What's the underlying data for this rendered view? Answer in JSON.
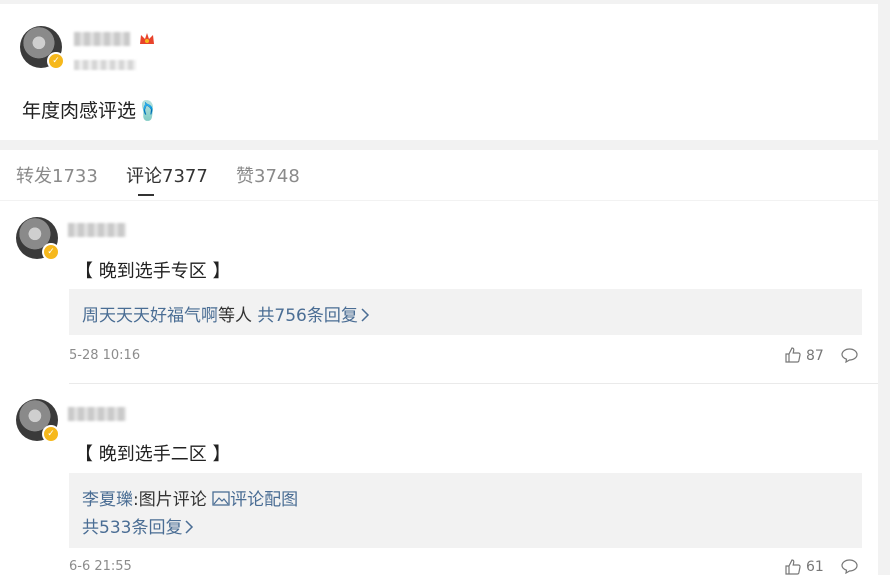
{
  "post": {
    "author_name": "",
    "time": "",
    "text": "年度肉感评选🩴"
  },
  "tabs": [
    {
      "label": "转发1733"
    },
    {
      "label": "评论7377"
    },
    {
      "label": "赞3748"
    }
  ],
  "comments": [
    {
      "text": "【 晚到选手专区 】",
      "reply_names": "周天天天好福气啊",
      "reply_mid": "等人",
      "reply_count": " 共756条回复",
      "time": "5-28 10:16",
      "likes": "87"
    },
    {
      "text": "【 晚到选手二区 】",
      "reply_user": "李夏瓅",
      "reply_colon": ":图片评论 ",
      "reply_link": "评论配图",
      "reply_count": "共533条回复",
      "time": "6-6 21:55",
      "likes": "61"
    }
  ],
  "colors": {
    "link": "#4a6d94",
    "badge": "#f6b81c",
    "crown": "#e8432b"
  }
}
